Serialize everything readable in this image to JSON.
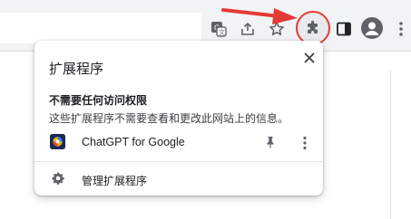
{
  "toolbar": {
    "icons": [
      "translate-icon",
      "share-icon",
      "bookmark-star-icon",
      "extensions-puzzle-icon",
      "side-panel-icon",
      "profile-avatar-icon",
      "menu-dots-icon"
    ],
    "highlight_color": "#e53935"
  },
  "popup": {
    "title": "扩展程序",
    "section_heading": "不需要任何访问权限",
    "section_desc": "这些扩展程序不需要查看和更改此网站上的信息。",
    "extensions": [
      {
        "name": "ChatGPT for Google",
        "icon": "chatgpt-for-google-logo"
      }
    ],
    "manage_label": "管理扩展程序"
  }
}
